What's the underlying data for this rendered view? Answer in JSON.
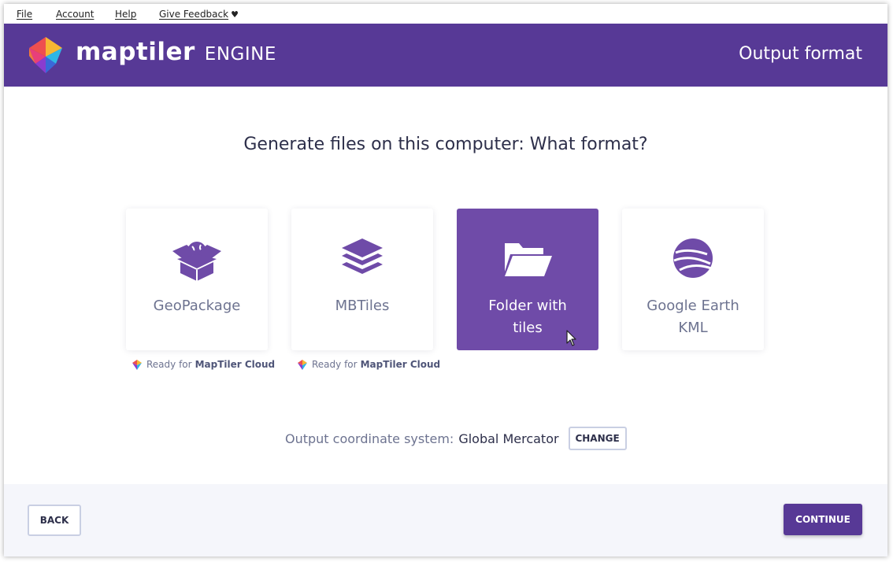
{
  "menu": {
    "items": [
      {
        "label": "File"
      },
      {
        "label": "Account"
      },
      {
        "label": "Help"
      },
      {
        "label": "Give Feedback"
      }
    ],
    "feedback_icon": "heart-icon"
  },
  "header": {
    "brand_name": "maptiler",
    "brand_sub": "ENGINE",
    "page_title": "Output format",
    "background_color": "#573996"
  },
  "main": {
    "question": "Generate files on this computer: What format?",
    "formats": [
      {
        "label": "GeoPackage",
        "icon": "open-box-globe-icon",
        "selected": false,
        "cloud_ready": true
      },
      {
        "label": "MBTiles",
        "icon": "layers-icon",
        "selected": false,
        "cloud_ready": true
      },
      {
        "label": "Folder with tiles",
        "icon": "folder-open-icon",
        "selected": true,
        "cloud_ready": false
      },
      {
        "label": "Google Earth KML",
        "icon": "google-earth-icon",
        "selected": false,
        "cloud_ready": false
      }
    ],
    "cloud_tag": {
      "prefix": "Ready for",
      "brand": "MapTiler Cloud"
    },
    "coordinate_system": {
      "label": "Output coordinate system:",
      "value": "Global Mercator",
      "change_label": "CHANGE"
    }
  },
  "footer": {
    "back_label": "BACK",
    "continue_label": "CONTINUE"
  },
  "colors": {
    "accent": "#573996",
    "selected_card": "#6f4ba8",
    "muted_text": "#6d7390"
  }
}
